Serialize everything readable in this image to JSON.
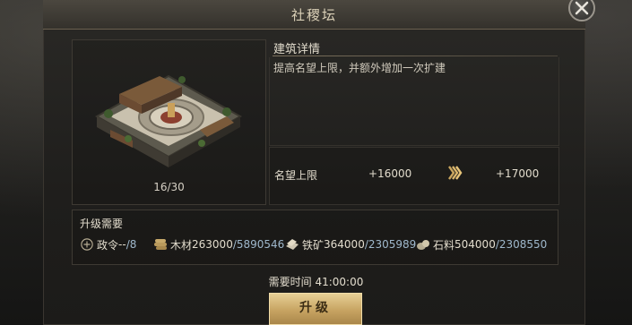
{
  "window": {
    "title": "社稷坛"
  },
  "building": {
    "count": "16/30"
  },
  "detail": {
    "title": "建筑详情",
    "description": "提高名望上限，并额外增加一次扩建",
    "stat": {
      "label": "名望上限",
      "current": "+16000",
      "next": "+17000"
    }
  },
  "requirements": {
    "title": "升级需要",
    "items": [
      {
        "icon": "order-icon",
        "name": "政令",
        "have": "--",
        "need": "/8"
      },
      {
        "icon": "wood-icon",
        "name": "木材",
        "have": "263000",
        "need": "/5890546"
      },
      {
        "icon": "iron-ore-icon",
        "name": "铁矿",
        "have": "364000",
        "need": "/2305989"
      },
      {
        "icon": "stone-icon",
        "name": "石料",
        "have": "504000",
        "need": "/2308550"
      }
    ]
  },
  "time": {
    "label": "需要时间",
    "value": "41:00:00"
  },
  "upgrade_button": {
    "label": "升级"
  }
}
